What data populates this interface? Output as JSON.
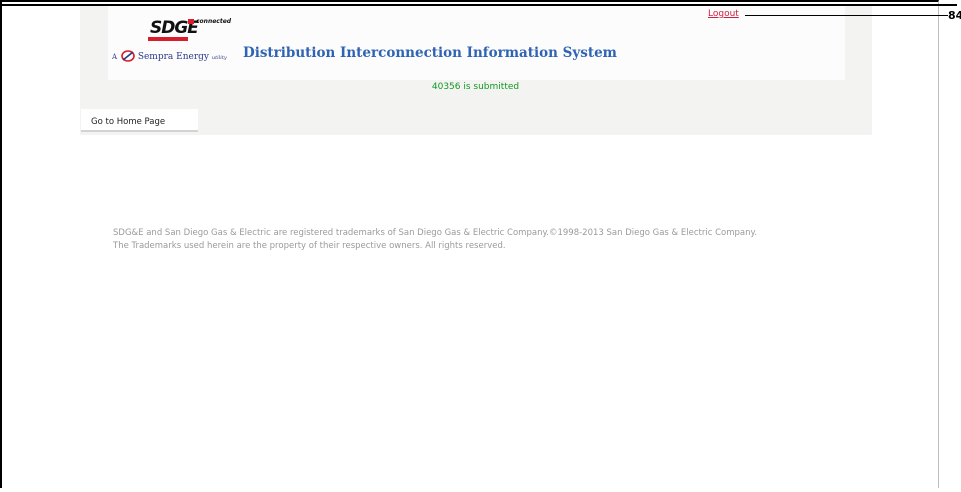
{
  "header": {
    "logo": {
      "brand": "SDGE",
      "brand_tag": "connected",
      "parent_prefix": "A",
      "parent_name": "Sempra Energy",
      "parent_suffix": "utility"
    },
    "system_title": "Distribution Interconnection Information System",
    "logout_label": "Logout",
    "callout_number": "84"
  },
  "status": {
    "message": "40356 is submitted"
  },
  "nav": {
    "home_label": "Go to Home Page"
  },
  "footer": {
    "line1": "SDG&E and San Diego Gas & Electric are registered trademarks of San Diego Gas & Electric Company.©1998-2013 San Diego Gas & Electric Company.",
    "line2": "The Trademarks used herein are the property of their respective owners. All rights reserved."
  },
  "colors": {
    "title_blue": "#2f63b3",
    "logout_red": "#d02040",
    "status_green": "#119922",
    "brand_red": "#d81e2c"
  }
}
